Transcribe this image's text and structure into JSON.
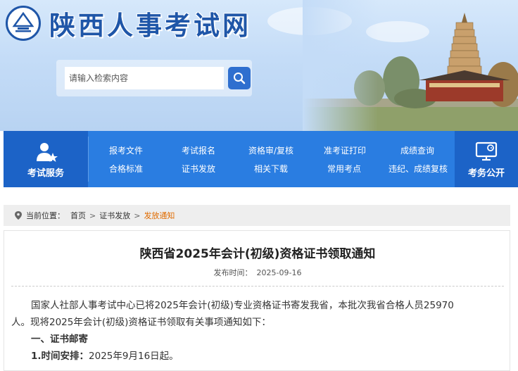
{
  "header": {
    "site_title": "陕西人事考试网",
    "search_placeholder": "请输入检索内容"
  },
  "nav": {
    "left_label": "考试服务",
    "right_label": "考务公开",
    "links": [
      {
        "top": "报考文件",
        "bottom": "合格标准"
      },
      {
        "top": "考试报名",
        "bottom": "证书发放"
      },
      {
        "top": "资格审/复核",
        "bottom": "相关下载"
      },
      {
        "top": "准考证打印",
        "bottom": "常用考点"
      },
      {
        "top": "成绩查询",
        "bottom": "违纪、成绩复核"
      }
    ]
  },
  "breadcrumb": {
    "prefix": "当前位置：",
    "items": [
      "首页",
      "证书发放",
      "发放通知"
    ],
    "separator": ">"
  },
  "article": {
    "title": "陕西省2025年会计(初级)资格证书领取通知",
    "published_label": "发布时间：",
    "published_date": "2025-09-16",
    "para1_line1": "国家人社部人事考试中心已将2025年会计(初级)专业资格证书寄发我省，本批次我省合格人员25970",
    "para1_line2": "人。现将2025年会计(初级)资格证书领取有关事项通知如下：",
    "section1": "一、证书邮寄",
    "item1_label": "1.时间安排：",
    "item1_text": "2025年9月16日起。"
  },
  "colors": {
    "brand_blue": "#1f56a8",
    "nav_blue": "#2a7de1",
    "nav_side": "#1c63c7",
    "crumb_active": "#e06b00"
  }
}
